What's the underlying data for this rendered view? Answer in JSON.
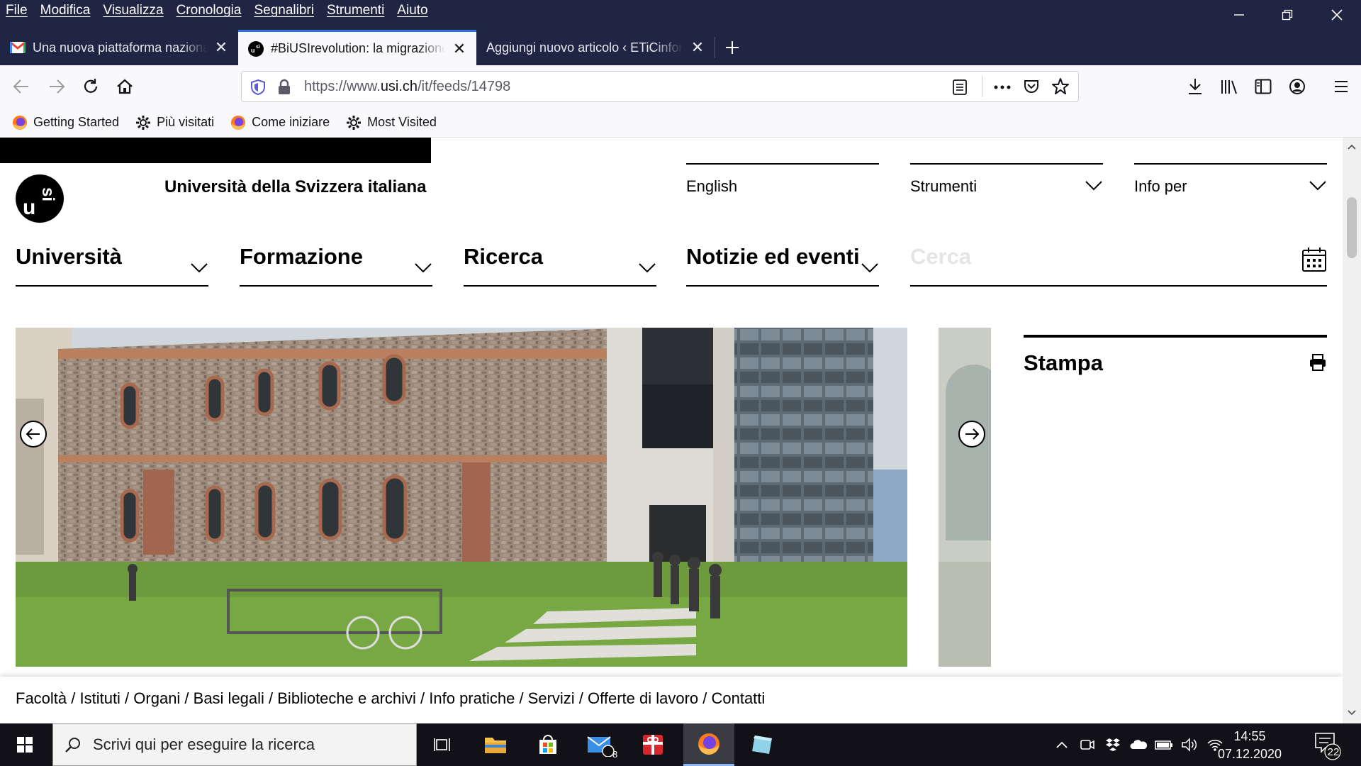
{
  "menubar": [
    "File",
    "Modifica",
    "Visualizza",
    "Cronologia",
    "Segnalibri",
    "Strumenti",
    "Aiuto"
  ],
  "tabs": [
    {
      "title": "Una nuova piattaforma nazionale",
      "favicon": "gmail-icon"
    },
    {
      "title": "#BiUSIrevolution: la migrazione",
      "favicon": "usi-icon",
      "active": true
    },
    {
      "title": "Aggiungi nuovo articolo ‹ ETiCinforma",
      "favicon": "none"
    }
  ],
  "url": {
    "prefix": "https://www.",
    "domain": "usi.ch",
    "path": "/it/feeds/14798"
  },
  "bookmarks": [
    {
      "label": "Getting Started",
      "icon": "firefox-icon"
    },
    {
      "label": "Più visitati",
      "icon": "gear-icon"
    },
    {
      "label": "Come iniziare",
      "icon": "firefox-icon"
    },
    {
      "label": "Most Visited",
      "icon": "gear-icon"
    }
  ],
  "site": {
    "name": "Università della Svizzera italiana",
    "top_links": [
      "English",
      "Strumenti",
      "Info per"
    ],
    "main_nav": [
      "Università",
      "Formazione",
      "Ricerca",
      "Notizie ed eventi"
    ],
    "search_placeholder": "Cerca",
    "stampa": "Stampa",
    "footer": "Facoltà / Istituti / Organi / Basi legali / Biblioteche e archivi / Info pratiche / Servizi / Offerte di lavoro / Contatti"
  },
  "taskbar": {
    "search_placeholder": "Scrivi qui per eseguire la ricerca",
    "time": "14:55",
    "date": "07.12.2020",
    "mail_badge": "8",
    "notifications": "22"
  },
  "colors": {
    "chrome": "#1f2543",
    "accent": "#2f6fe0",
    "taskbar": "#111117"
  }
}
